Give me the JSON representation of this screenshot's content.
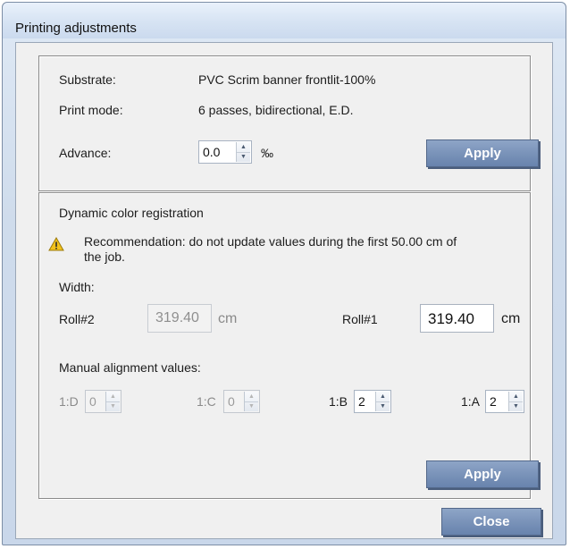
{
  "window": {
    "title": "Printing adjustments"
  },
  "settings": {
    "substrate_label": "Substrate:",
    "substrate_value": "PVC Scrim banner frontlit-100%",
    "print_mode_label": "Print mode:",
    "print_mode_value": "6 passes, bidirectional, E.D.",
    "advance_label": "Advance:",
    "advance_value": "0.0",
    "advance_unit": "‰",
    "apply_label": "Apply"
  },
  "registration": {
    "title": "Dynamic color registration",
    "recommendation_line1": "Recommendation: do not update values during the first 50.00 cm of",
    "recommendation_line2": "the job.",
    "width_label": "Width:",
    "roll2_label": "Roll#2",
    "roll2_value": "319.40",
    "roll2_unit": "cm",
    "roll1_label": "Roll#1",
    "roll1_value": "319.40",
    "roll1_unit": "cm",
    "manual_label": "Manual alignment values:",
    "alignments": [
      {
        "label": "1:D",
        "value": "0",
        "enabled": false
      },
      {
        "label": "1:C",
        "value": "0",
        "enabled": false
      },
      {
        "label": "1:B",
        "value": "2",
        "enabled": true
      },
      {
        "label": "1:A",
        "value": "2",
        "enabled": true
      }
    ],
    "apply_label": "Apply"
  },
  "footer": {
    "close_label": "Close"
  },
  "icons": {
    "warning": "warning-icon",
    "spin_up": "spin-up-arrow-icon",
    "spin_down": "spin-down-arrow-icon"
  }
}
